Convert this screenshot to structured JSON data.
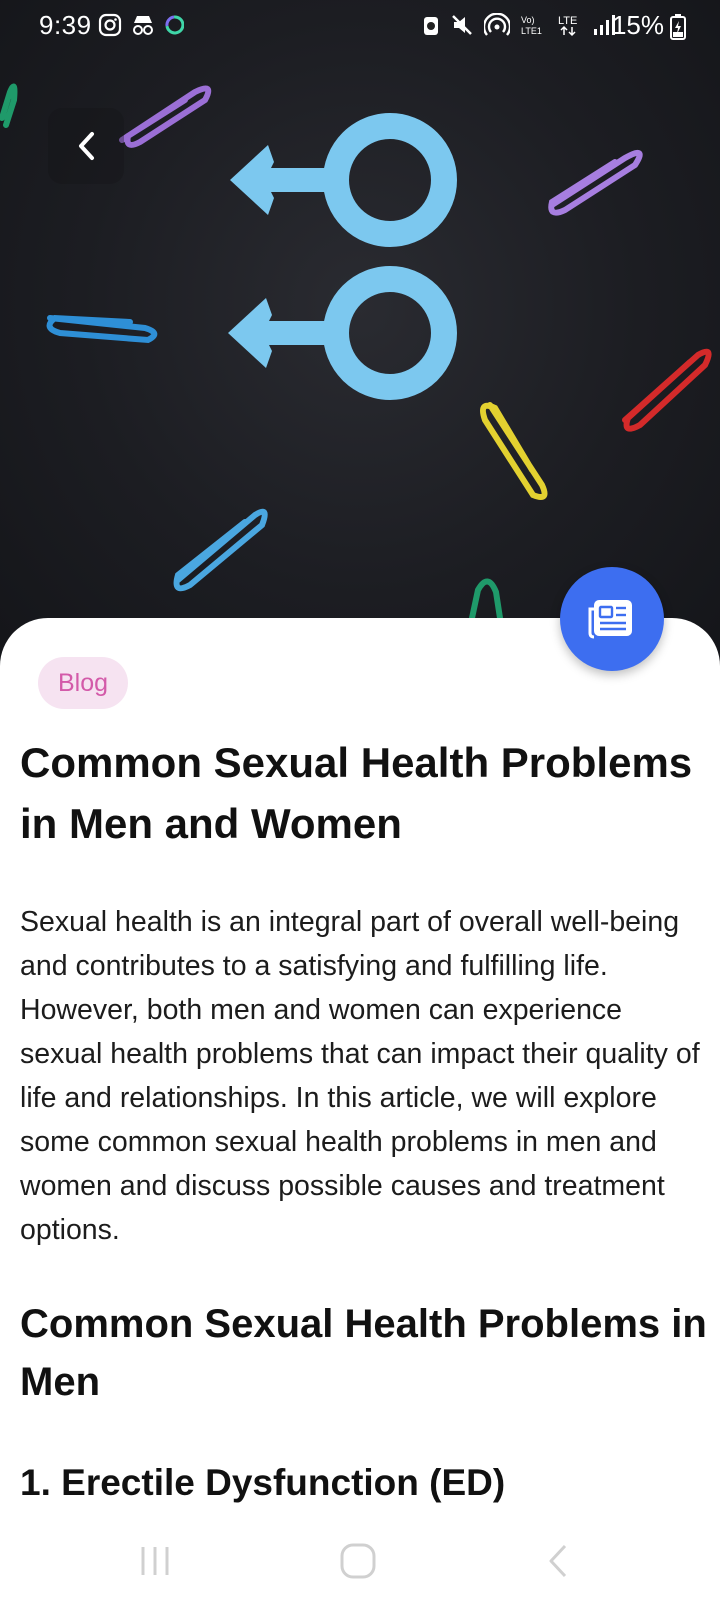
{
  "status_bar": {
    "time": "9:39",
    "battery": "15%",
    "left_icons": [
      "instagram-icon",
      "incognito-icon",
      "sync-icon"
    ],
    "right_icons": [
      "alarm-icon",
      "mute-icon",
      "hotspot-icon",
      "volte-icon",
      "lte-icon",
      "signal-icon",
      "battery-icon"
    ]
  },
  "hero": {
    "image": "gender-symbols-with-paperclips",
    "back_icon": "chevron-left-icon"
  },
  "fab": {
    "icon": "newspaper-icon",
    "color": "#3d6ef0"
  },
  "article": {
    "category": "Blog",
    "title": "Common Sexual Health Problems in Men and Women",
    "intro": "Sexual health is an integral part of overall well-being and contributes to a satisfying and fulfilling life. However, both men and women can experience sexual health problems that can impact their quality of life and relationships. In this article, we will explore some common sexual health problems in men and women and discuss possible causes and treatment options.",
    "section_heading": "Common Sexual Health Problems in Men",
    "subsection_heading": "1. Erectile Dysfunction (ED)"
  },
  "colors": {
    "chip_bg": "#f6e3f1",
    "chip_text": "#d35aa9",
    "symbol_blue": "#7cc8ef",
    "hero_bg": "#1c1d22"
  },
  "nav_bar": {
    "buttons": [
      "recent-apps-icon",
      "home-icon",
      "back-icon"
    ]
  }
}
